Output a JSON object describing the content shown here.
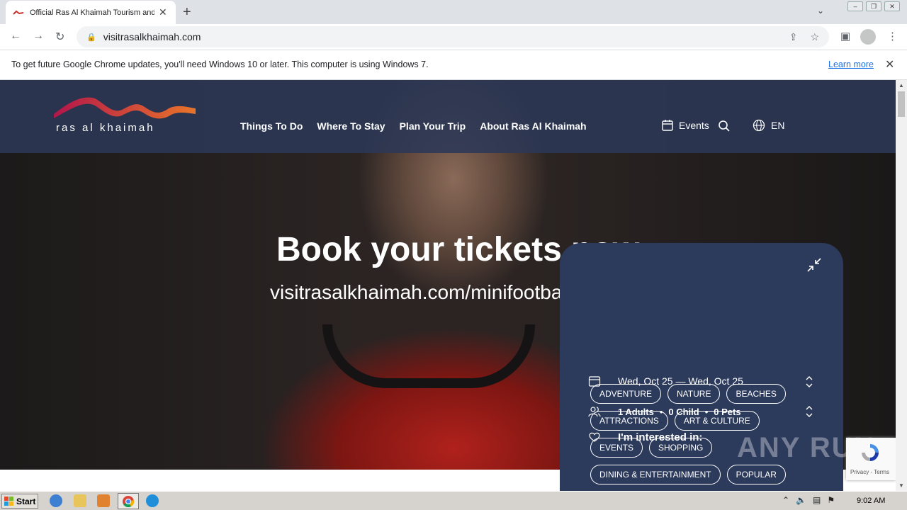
{
  "browser": {
    "tab_title": "Official Ras Al Khaimah Tourism and V",
    "new_tab": "+",
    "url": "visitrasalkhaimah.com"
  },
  "infobar": {
    "message": "To get future Google Chrome updates, you'll need Windows 10 or later. This computer is using Windows 7.",
    "link": "Learn more"
  },
  "header": {
    "logo_text": "ras al khaimah",
    "nav": [
      "Things To Do",
      "Where To Stay",
      "Plan Your Trip",
      "About Ras Al Khaimah"
    ],
    "events_label": "Events",
    "language": "EN"
  },
  "hero": {
    "title": "Book your tickets now",
    "subtitle": "visitrasalkhaimah.com/minifootball"
  },
  "booking": {
    "dates": "Wed, Oct 25 — Wed, Oct 25",
    "adults": "1 Adults",
    "children": "0 Child",
    "pets": "0 Pets",
    "dot": "•",
    "interest_label": "I'm interested in:",
    "tags": [
      "ADVENTURE",
      "NATURE",
      "BEACHES",
      "ATTRACTIONS",
      "ART & CULTURE",
      "EVENTS",
      "SHOPPING",
      "DINING & ENTERTAINMENT",
      "POPULAR"
    ]
  },
  "recaptcha": {
    "text": "Privacy - Terms"
  },
  "watermark": "ANY RUN",
  "taskbar": {
    "start": "Start",
    "time": "9:02 AM"
  },
  "colors": {
    "header_bg": "#2c3856",
    "panel_bg": "#2c3a5c",
    "logo_gradient_start": "#b3164a",
    "logo_gradient_end": "#e8742a"
  }
}
